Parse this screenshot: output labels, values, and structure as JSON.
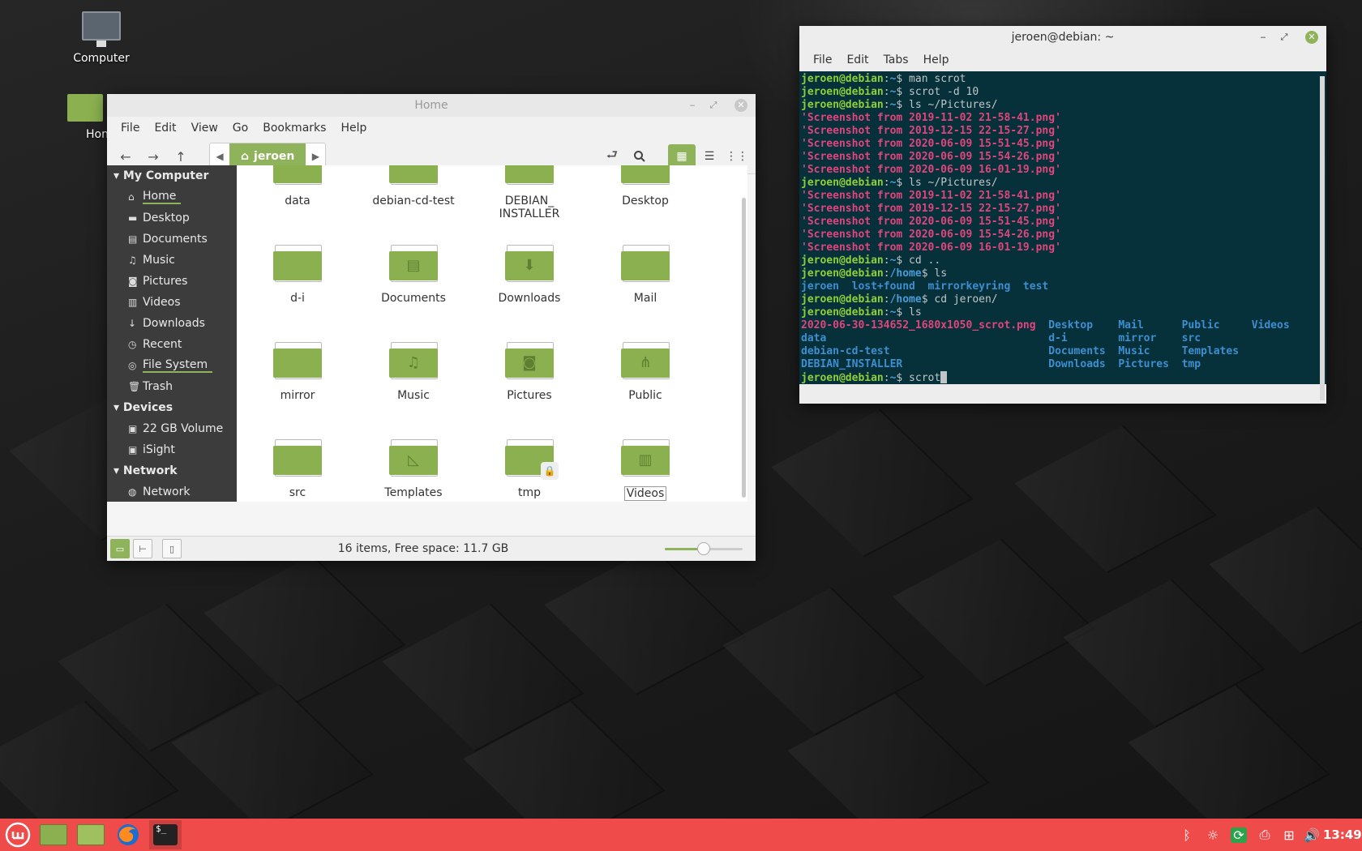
{
  "desktop": {
    "icons": [
      {
        "label": "Computer"
      },
      {
        "label": "Hon"
      }
    ]
  },
  "file_manager": {
    "title": "Home",
    "menu": [
      "File",
      "Edit",
      "View",
      "Go",
      "Bookmarks",
      "Help"
    ],
    "breadcrumb": "jeroen",
    "sidebar": {
      "sections": [
        {
          "header": "My Computer",
          "items": [
            "Home",
            "Desktop",
            "Documents",
            "Music",
            "Pictures",
            "Videos",
            "Downloads",
            "Recent",
            "File System",
            "Trash"
          ]
        },
        {
          "header": "Devices",
          "items": [
            "22 GB Volume",
            "iSight"
          ]
        },
        {
          "header": "Network",
          "items": [
            "Network"
          ]
        }
      ]
    },
    "items": [
      {
        "name": "data",
        "emblem": ""
      },
      {
        "name": "debian-cd-test",
        "emblem": ""
      },
      {
        "name": "DEBIAN_\nINSTALLER",
        "emblem": ""
      },
      {
        "name": "Desktop",
        "emblem": ""
      },
      {
        "name": "d-i",
        "emblem": ""
      },
      {
        "name": "Documents",
        "emblem": "document-icon"
      },
      {
        "name": "Downloads",
        "emblem": "download-icon"
      },
      {
        "name": "Mail",
        "emblem": ""
      },
      {
        "name": "mirror",
        "emblem": ""
      },
      {
        "name": "Music",
        "emblem": "music-icon"
      },
      {
        "name": "Pictures",
        "emblem": "camera-icon"
      },
      {
        "name": "Public",
        "emblem": "share-icon"
      },
      {
        "name": "src",
        "emblem": ""
      },
      {
        "name": "Templates",
        "emblem": "template-icon"
      },
      {
        "name": "tmp",
        "emblem": "lock-icon"
      },
      {
        "name": "Videos",
        "emblem": "film-icon"
      }
    ],
    "status": "16 items, Free space: 11.7 GB",
    "zoom_level": 0.5
  },
  "terminal": {
    "title": "jeroen@debian: ~",
    "menu": [
      "File",
      "Edit",
      "Tabs",
      "Help"
    ],
    "lines": [
      [
        [
          "u",
          "jeroen@debian"
        ],
        [
          "t",
          ":"
        ],
        [
          "p",
          "~"
        ],
        [
          "t",
          "$ man scrot"
        ]
      ],
      [
        [
          "u",
          "jeroen@debian"
        ],
        [
          "t",
          ":"
        ],
        [
          "p",
          "~"
        ],
        [
          "t",
          "$ scrot -d 10"
        ]
      ],
      [
        [
          "u",
          "jeroen@debian"
        ],
        [
          "t",
          ":"
        ],
        [
          "p",
          "~"
        ],
        [
          "t",
          "$ ls ~/Pictures/"
        ]
      ],
      [
        [
          "k",
          "'Screenshot from 2019-11-02 21-58-41.png'"
        ]
      ],
      [
        [
          "k",
          "'Screenshot from 2019-12-15 22-15-27.png'"
        ]
      ],
      [
        [
          "k",
          "'Screenshot from 2020-06-09 15-51-45.png'"
        ]
      ],
      [
        [
          "k",
          "'Screenshot from 2020-06-09 15-54-26.png'"
        ]
      ],
      [
        [
          "k",
          "'Screenshot from 2020-06-09 16-01-19.png'"
        ]
      ],
      [
        [
          "u",
          "jeroen@debian"
        ],
        [
          "t",
          ":"
        ],
        [
          "p",
          "~"
        ],
        [
          "t",
          "$ ls ~/Pictures/"
        ]
      ],
      [
        [
          "k",
          "'Screenshot from 2019-11-02 21-58-41.png'"
        ]
      ],
      [
        [
          "k",
          "'Screenshot from 2019-12-15 22-15-27.png'"
        ]
      ],
      [
        [
          "k",
          "'Screenshot from 2020-06-09 15-51-45.png'"
        ]
      ],
      [
        [
          "k",
          "'Screenshot from 2020-06-09 15-54-26.png'"
        ]
      ],
      [
        [
          "k",
          "'Screenshot from 2020-06-09 16-01-19.png'"
        ]
      ],
      [
        [
          "u",
          "jeroen@debian"
        ],
        [
          "t",
          ":"
        ],
        [
          "p",
          "~"
        ],
        [
          "t",
          "$ cd .."
        ]
      ],
      [
        [
          "u",
          "jeroen@debian"
        ],
        [
          "t",
          ":"
        ],
        [
          "p",
          "/home"
        ],
        [
          "t",
          "$ ls"
        ]
      ],
      [
        [
          "b",
          "jeroen  lost+found  mirrorkeyring  test"
        ]
      ],
      [
        [
          "u",
          "jeroen@debian"
        ],
        [
          "t",
          ":"
        ],
        [
          "p",
          "/home"
        ],
        [
          "t",
          "$ cd jeroen/"
        ]
      ],
      [
        [
          "u",
          "jeroen@debian"
        ],
        [
          "t",
          ":"
        ],
        [
          "p",
          "~"
        ],
        [
          "t",
          "$ ls"
        ]
      ],
      [
        [
          "k",
          "2020-06-30-134652_1680x1050_scrot.png"
        ],
        [
          "t",
          "  "
        ],
        [
          "b",
          "Desktop    Mail      Public     Videos"
        ]
      ],
      [
        [
          "b",
          "data                                   d-i        mirror    src"
        ]
      ],
      [
        [
          "b",
          "debian-cd-test                         Documents  Music     Templates"
        ]
      ],
      [
        [
          "b",
          "DEBIAN_INSTALLER                       Downloads  Pictures  tmp"
        ]
      ],
      [
        [
          "u",
          "jeroen@debian"
        ],
        [
          "t",
          ":"
        ],
        [
          "p",
          "~"
        ],
        [
          "t",
          "$ scrot"
        ],
        [
          "c",
          ""
        ]
      ]
    ]
  },
  "panel": {
    "clock": "13:49",
    "launchers": [
      "menu-icon",
      "files-icon",
      "folder-icon",
      "firefox-icon",
      "terminal-icon"
    ],
    "tray": [
      "bluetooth-icon",
      "update-icon",
      "sync-icon",
      "printer-icon",
      "network-icon",
      "volume-icon"
    ]
  },
  "colors": {
    "accent": "#8fb35a",
    "panel": "#ef4b4b",
    "terminal_bg": "#06303a",
    "prompt_user": "#8fcf3a",
    "prompt_path": "#4b9bd5",
    "image_file": "#e0457b",
    "directory": "#3d8fd0"
  }
}
